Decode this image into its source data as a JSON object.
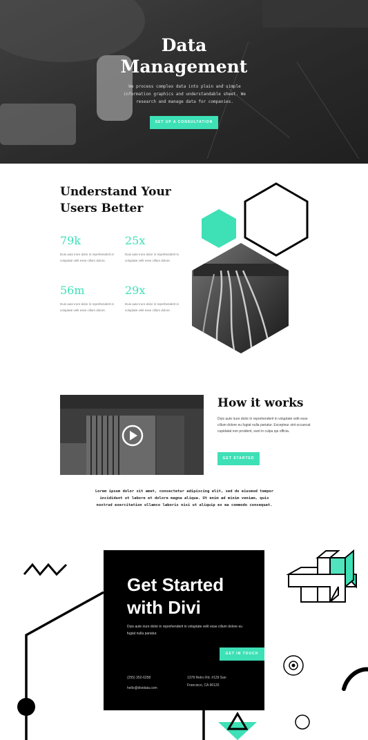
{
  "hero": {
    "title_line1": "Data",
    "title_line2": "Management",
    "subtitle": "We process complex data into plain and simple information graphics and understandable sheet. We research and manage data for companies.",
    "button": "SET UP A CONSULTATION"
  },
  "users": {
    "title_line1": "Understand Your",
    "title_line2": "Users Better",
    "stats": [
      {
        "value": "79k",
        "desc": "Duis aute irure dolor in reprehenderit in voluptate velit esse cillum dolore."
      },
      {
        "value": "25x",
        "desc": "Duis aute irure dolor in reprehenderit in voluptate velit esse cillum dolore."
      },
      {
        "value": "56m",
        "desc": "Duis aute irure dolor in reprehenderit in voluptate velit esse cillum dolore."
      },
      {
        "value": "29x",
        "desc": "Duis aute irure dolor in reprehenderit in voluptate velit esse cillum dolore."
      }
    ]
  },
  "how": {
    "title": "How it works",
    "text": "Duis aute irure dolor in reprehenderit in voluptate velit esse cillum dolore eu fugiat nulla pariatur. Excepteur sint occaecat cupidatat non proident, sunt in culpa qui officia.",
    "button": "GET STARTED",
    "lorem": "Lorem ipsum dolor sit amet, consectetur adipiscing elit, sed do eiusmod tempor incididunt ut labore et dolore magna aliqua. Ut enim ad minim veniam, quis nostrud exercitation ullamco laboris nisi ut aliquip ex ea commodo consequat."
  },
  "cta": {
    "title_line1": "Get Started",
    "title_line2": "with Divi",
    "text": "Duis aute irure dolor in reprehenderit in voluptate velit esse cillum dolore eu fugiat nulla pariatur.",
    "button": "GET IN TOUCH",
    "phone": "(255) 352-6258",
    "email": "hello@dividata.com",
    "address_line1": "1378 Retro Rd. #129 San",
    "address_line2": "Francisco, CA 96120"
  },
  "colors": {
    "accent": "#3ee0b6",
    "dark": "#000000"
  },
  "icons": {
    "video_play": "play-icon"
  }
}
